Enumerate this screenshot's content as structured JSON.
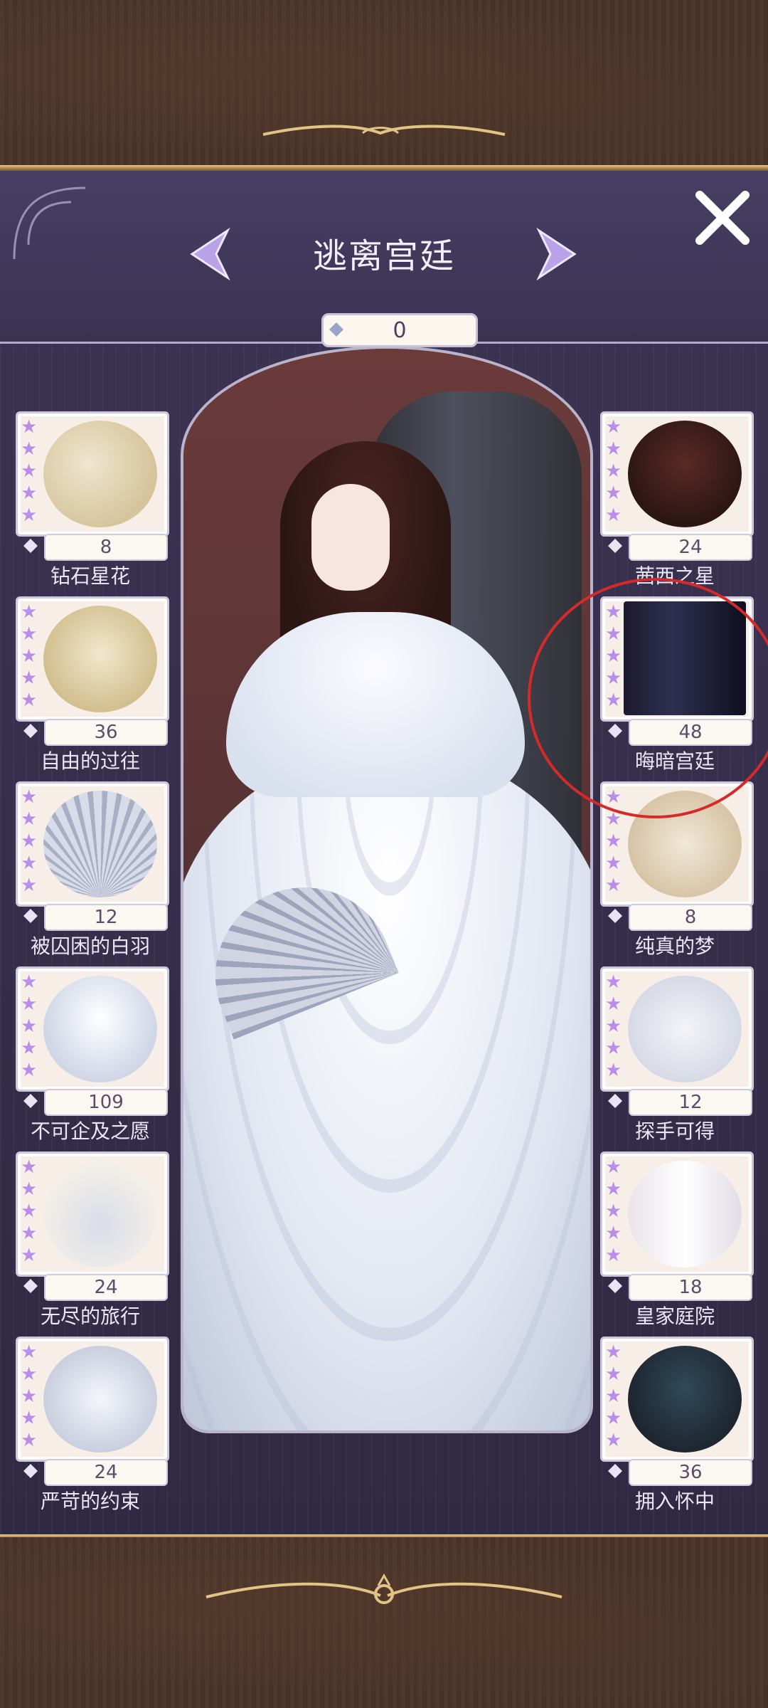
{
  "header": {
    "title": "逃离宫廷",
    "counter": "0"
  },
  "colors": {
    "panel": "#3c3453",
    "star": "#b98ee8",
    "annotation": "#d52a2a"
  },
  "items_left": [
    {
      "label": "钻石星花",
      "count": "8",
      "stars": 5,
      "icon": "hair-accessory"
    },
    {
      "label": "自由的过往",
      "count": "36",
      "stars": 5,
      "icon": "hairstyle"
    },
    {
      "label": "被囚困的白羽",
      "count": "12",
      "stars": 5,
      "icon": "feather-fan"
    },
    {
      "label": "不可企及之愿",
      "count": "109",
      "stars": 5,
      "icon": "dress"
    },
    {
      "label": "无尽的旅行",
      "count": "24",
      "stars": 5,
      "icon": "shoes"
    },
    {
      "label": "严苛的约束",
      "count": "24",
      "stars": 5,
      "icon": "corset"
    }
  ],
  "items_right": [
    {
      "label": "茜西之星",
      "count": "24",
      "stars": 5,
      "icon": "hair-stars"
    },
    {
      "label": "晦暗宫廷",
      "count": "48",
      "stars": 5,
      "icon": "dark-background"
    },
    {
      "label": "纯真的梦",
      "count": "8",
      "stars": 5,
      "icon": "necklace"
    },
    {
      "label": "探手可得",
      "count": "12",
      "stars": 5,
      "icon": "gloves"
    },
    {
      "label": "皇家庭院",
      "count": "18",
      "stars": 5,
      "icon": "stockings"
    },
    {
      "label": "拥入怀中",
      "count": "36",
      "stars": 5,
      "icon": "veil"
    }
  ]
}
